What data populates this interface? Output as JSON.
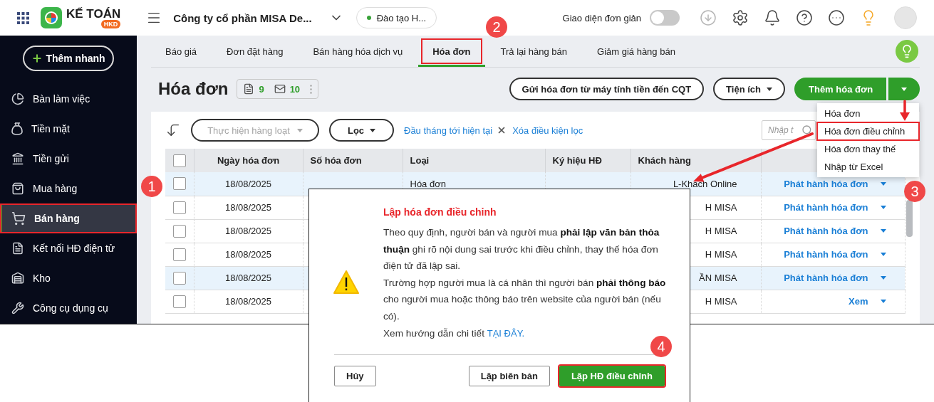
{
  "header": {
    "app_name": "KẾ TOÁN",
    "app_badge": "HKD",
    "company": "Công ty cổ phần MISA De...",
    "workspace": "Đào tạo H...",
    "simple_mode": {
      "label": "Giao diện đơn giản",
      "on": false
    }
  },
  "sidebar": {
    "quick_add": "Thêm nhanh",
    "items": [
      {
        "label": "Bàn làm việc",
        "selected": false,
        "marked": false
      },
      {
        "label": "Tiền mặt",
        "selected": false,
        "marked": false
      },
      {
        "label": "Tiền gửi",
        "selected": false,
        "marked": false
      },
      {
        "label": "Mua hàng",
        "selected": false,
        "marked": false
      },
      {
        "label": "Bán hàng",
        "selected": true,
        "marked": true
      },
      {
        "label": "Kết nối HĐ điện tử",
        "selected": false,
        "marked": false
      },
      {
        "label": "Kho",
        "selected": false,
        "marked": false
      },
      {
        "label": "Công cụ dụng cụ",
        "selected": false,
        "marked": false
      }
    ]
  },
  "tabs": [
    {
      "label": "Báo giá",
      "selected": false,
      "marked": false
    },
    {
      "label": "Đơn đặt hàng",
      "selected": false,
      "marked": false
    },
    {
      "label": "Bán hàng hóa dịch vụ",
      "selected": false,
      "marked": false
    },
    {
      "label": "Hóa đơn",
      "selected": true,
      "marked": true
    },
    {
      "label": "Trả lại hàng bán",
      "selected": false,
      "marked": false
    },
    {
      "label": "Giảm giá hàng bán",
      "selected": false,
      "marked": false
    }
  ],
  "page": {
    "title": "Hóa đơn",
    "counts": [
      "9",
      "10"
    ],
    "send_button": "Gửi hóa đơn từ máy tính tiền đến CQT",
    "utilities_button": "Tiện ích",
    "add_button": "Thêm hóa đơn"
  },
  "toolbar": {
    "bulk_action": {
      "label": "Thực hiện hàng loạt",
      "disabled": true
    },
    "filter": "Lọc",
    "filter_chip": "Đầu tháng tới hiện tại",
    "clear_filter": "Xóa điều kiện lọc",
    "search": {
      "placeholder": "Nhập t"
    }
  },
  "table": {
    "all_checked": false,
    "columns": [
      "Ngày hóa đơn",
      "Số hóa đơn",
      "Loại",
      "Ký hiệu HĐ",
      "Khách hàng"
    ],
    "rows": [
      {
        "checked": false,
        "highlighted": true,
        "date": "18/08/2025",
        "type": "Hóa đơn",
        "customer": "L-Khách Online",
        "action": "Phát hành hóa đơn"
      },
      {
        "checked": false,
        "highlighted": false,
        "date": "18/08/2025",
        "customer": "H MISA",
        "action": "Phát hành hóa đơn"
      },
      {
        "checked": false,
        "highlighted": false,
        "date": "18/08/2025",
        "customer": "H MISA",
        "action": "Phát hành hóa đơn"
      },
      {
        "checked": false,
        "highlighted": false,
        "date": "18/08/2025",
        "customer": "H MISA",
        "action": "Phát hành hóa đơn"
      },
      {
        "checked": false,
        "highlighted": true,
        "date": "18/08/2025",
        "customer": "ẦN MISA",
        "action": "Phát hành hóa đơn"
      },
      {
        "checked": false,
        "highlighted": false,
        "date": "18/08/2025",
        "customer": "H MISA",
        "action": "Xem"
      }
    ]
  },
  "add_menu": {
    "items": [
      {
        "label": "Hóa đơn",
        "marked": false
      },
      {
        "label": "Hóa đơn điều chỉnh",
        "marked": true
      },
      {
        "label": "Hóa đơn thay thế",
        "marked": false
      },
      {
        "label": "Nhập từ Excel",
        "marked": false
      }
    ]
  },
  "dialog": {
    "title": "Lập hóa đơn điều chỉnh",
    "paragraphs": [
      "Theo quy định, người bán và người mua **phải lập văn bản thỏa thuận** ghi rõ nội dung sai trước khi điều chỉnh, thay thế hóa đơn điện tử đã lập sai.",
      "Trường hợp người mua là cá nhân thì người bán **phải thông báo** cho người mua hoặc thông báo trên website của người bán (nếu có)."
    ],
    "guide_text": "Xem hướng dẫn chi tiết",
    "guide_link": "TẠI ĐÂY.",
    "buttons": [
      {
        "label": "Hủy",
        "kind": "default",
        "marked": false
      },
      {
        "label": "Lập biên bản",
        "kind": "default",
        "marked": false
      },
      {
        "label": "Lập HĐ điều chỉnh",
        "kind": "primary",
        "marked": true
      }
    ]
  },
  "callouts": [
    "1",
    "2",
    "3",
    "4"
  ]
}
